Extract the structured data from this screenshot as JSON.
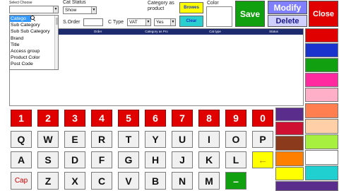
{
  "form": {
    "select_choose_label": "Select Choose",
    "select_choose_value": "",
    "dropdown_items": [
      "Catego",
      "Sub Category",
      "Sub Sub Category",
      "Brand",
      "Title",
      "Access group",
      "Product Color",
      "Post Code"
    ],
    "cat_status_label": "Cat Status",
    "cat_status_value": "Show",
    "category_as_product_label": "Category as product",
    "color_label": "Color",
    "browse_label": "Browes",
    "clear_label": "Clear",
    "s_order_label": "S.Order",
    "c_type_label": "C Type",
    "c_type_value": "VAT",
    "yes_value": "Yes"
  },
  "actions": {
    "save": "Save",
    "modify": "Modify",
    "delete": "Delete",
    "close": "Close"
  },
  "table": {
    "columns": [
      "Name",
      "Order",
      "Category as Pro",
      "Cat type",
      "Status"
    ]
  },
  "keyboard": {
    "numbers": [
      "1",
      "2",
      "3",
      "4",
      "5",
      "6",
      "7",
      "8",
      "9",
      "0"
    ],
    "row1": [
      "Q",
      "W",
      "E",
      "R",
      "T",
      "Y",
      "U",
      "I",
      "O",
      "P"
    ],
    "row2": [
      "A",
      "S",
      "D",
      "F",
      "G",
      "H",
      "J",
      "K",
      "L"
    ],
    "enter_glyph": "←",
    "cap_label": "Cap",
    "row3": [
      "Z",
      "X",
      "C",
      "V",
      "B",
      "N",
      "M"
    ],
    "dash_label": "–"
  },
  "colors": {
    "palette_right": [
      "#e00000",
      "#1a33cc",
      "#10a010",
      "#ff2aa0",
      "#ffb0c8",
      "#ff7f50",
      "#ffd0a8",
      "#a8f040",
      "#ffffff",
      "#20d0d0"
    ],
    "palette_left": [
      "#5a2d8c",
      "#d01030",
      "#8b3b1b",
      "#ff8000",
      "#ffff00"
    ],
    "save_bg": "#10a010",
    "modify_bg": "#8080ff",
    "delete_bg": "#d0d0ff",
    "close_bg": "#e00000"
  }
}
